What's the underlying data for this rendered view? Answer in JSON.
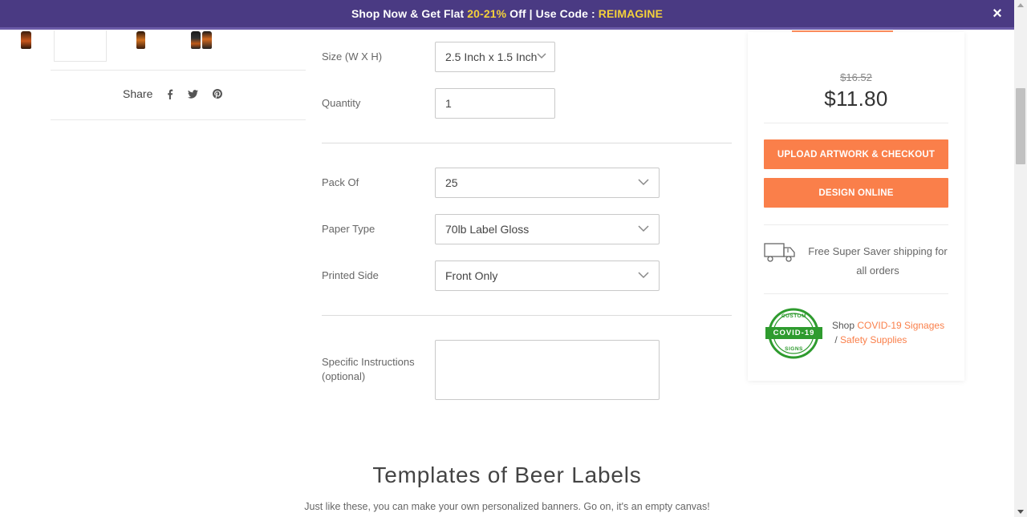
{
  "promo": {
    "prefix": "Shop Now & Get Flat ",
    "discount": "20-21%",
    "middle": " Off | Use Code : ",
    "code": "REIMAGINE",
    "close_icon": "×"
  },
  "share": {
    "label": "Share"
  },
  "form": {
    "size_label": "Size (W X H)",
    "size_value": "2.5 Inch x 1.5 Inch",
    "quantity_label": "Quantity",
    "quantity_value": "1",
    "pack_label": "Pack Of",
    "pack_value": "25",
    "paper_label": "Paper Type",
    "paper_value": "70lb Label Gloss",
    "printed_label": "Printed Side",
    "printed_value": "Front Only",
    "instructions_label_1": "Specific Instructions",
    "instructions_label_2": "(optional)",
    "instructions_value": ""
  },
  "pricing": {
    "old_price": "$16.52",
    "new_price": "$11.80",
    "upload_button": "UPLOAD ARTWORK & CHECKOUT",
    "design_button": "DESIGN ONLINE",
    "shipping_text": "Free Super Saver shipping for all orders",
    "covid_prefix": "Shop ",
    "covid_link": "COVID-19 Signages",
    "covid_sep": " / ",
    "safety_link": "Safety Supplies"
  },
  "covid_badge": {
    "top": "CUSTOM",
    "middle": "COVID-19",
    "bottom": "SIGNS"
  },
  "templates": {
    "title": "Templates of Beer Labels",
    "subtitle": "Just like these, you can make your own personalized banners. Go on, it's an empty canvas!"
  },
  "colors": {
    "banner": "#4a3a83",
    "highlight": "#f4d13a",
    "accent": "#fa7f4a",
    "badge_green": "#2e9b2e"
  }
}
